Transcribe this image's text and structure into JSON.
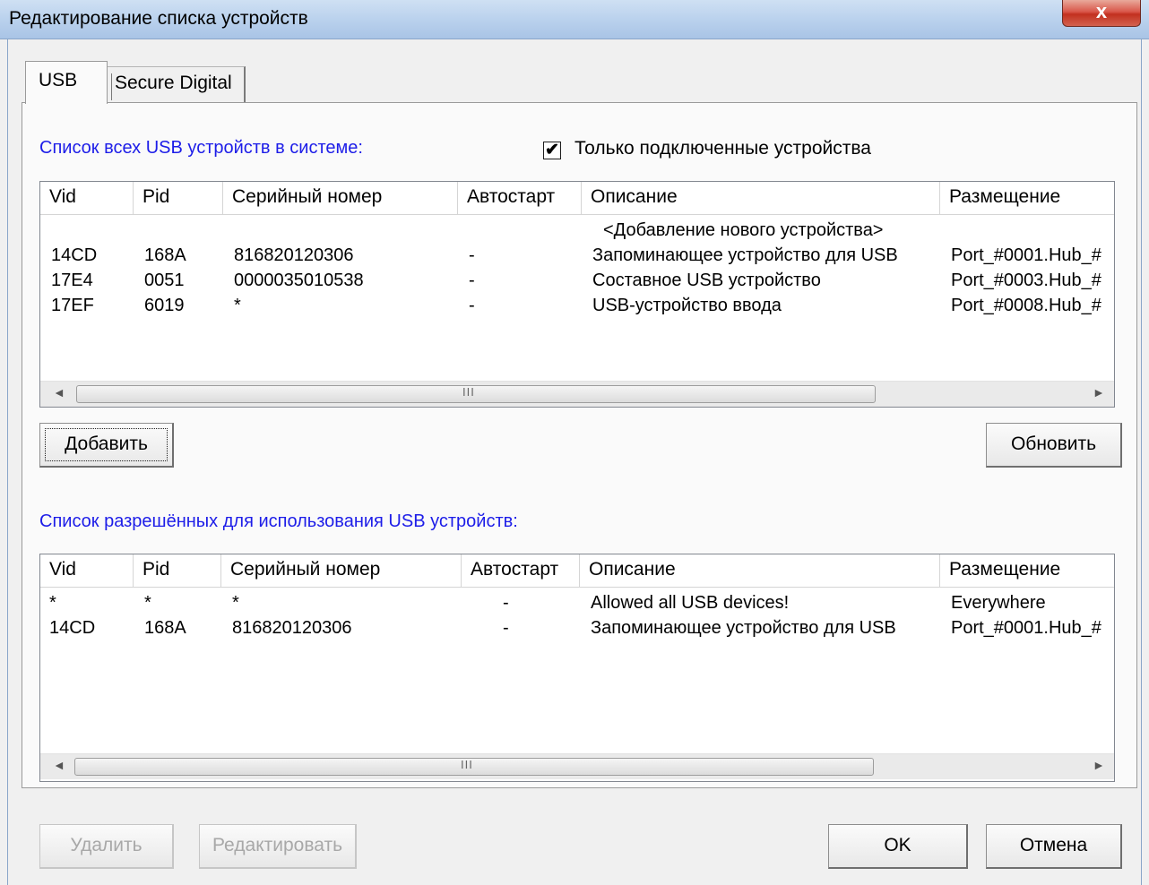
{
  "window": {
    "title": "Редактирование списка устройств",
    "close_glyph": "x"
  },
  "tabs": [
    {
      "label": "USB"
    },
    {
      "label": "Secure Digital"
    }
  ],
  "all_devices": {
    "label": "Список всех USB устройств в системе:",
    "only_connected_label": "Только подключенные устройства",
    "only_connected_checked": true,
    "check_glyph": "✔",
    "columns": [
      "Vid",
      "Pid",
      "Серийный номер",
      "Автостарт",
      "Описание",
      "Размещение"
    ],
    "add_new_row": "<Добавление нового устройства>",
    "rows": [
      {
        "vid": "14CD",
        "pid": "168A",
        "serial": "816820120306",
        "autostart": "-",
        "description": "Запоминающее устройство для USB",
        "location": "Port_#0001.Hub_#"
      },
      {
        "vid": "17E4",
        "pid": "0051",
        "serial": "0000035010538",
        "autostart": "-",
        "description": "Составное USB устройство",
        "location": "Port_#0003.Hub_#"
      },
      {
        "vid": "17EF",
        "pid": "6019",
        "serial": "*",
        "autostart": "-",
        "description": "USB-устройство ввода",
        "location": "Port_#0008.Hub_#"
      }
    ],
    "scroll_grip": "III"
  },
  "allowed_devices": {
    "label": "Список разрешённых для использования USB устройств:",
    "columns": [
      "Vid",
      "Pid",
      "Серийный номер",
      "Автостарт",
      "Описание",
      "Размещение"
    ],
    "rows": [
      {
        "vid": "*",
        "pid": "*",
        "serial": "*",
        "autostart": "-",
        "description": "Allowed all USB devices!",
        "location": "Everywhere"
      },
      {
        "vid": "14CD",
        "pid": "168A",
        "serial": "816820120306",
        "autostart": "-",
        "description": "Запоминающее устройство для USB",
        "location": "Port_#0001.Hub_#"
      }
    ],
    "scroll_grip": "III"
  },
  "buttons": {
    "add": "Добавить",
    "refresh": "Обновить",
    "delete": "Удалить",
    "edit": "Редактировать",
    "ok": "OK",
    "cancel": "Отмена"
  },
  "icons": {
    "scroll_left": "◄",
    "scroll_right": "►"
  }
}
